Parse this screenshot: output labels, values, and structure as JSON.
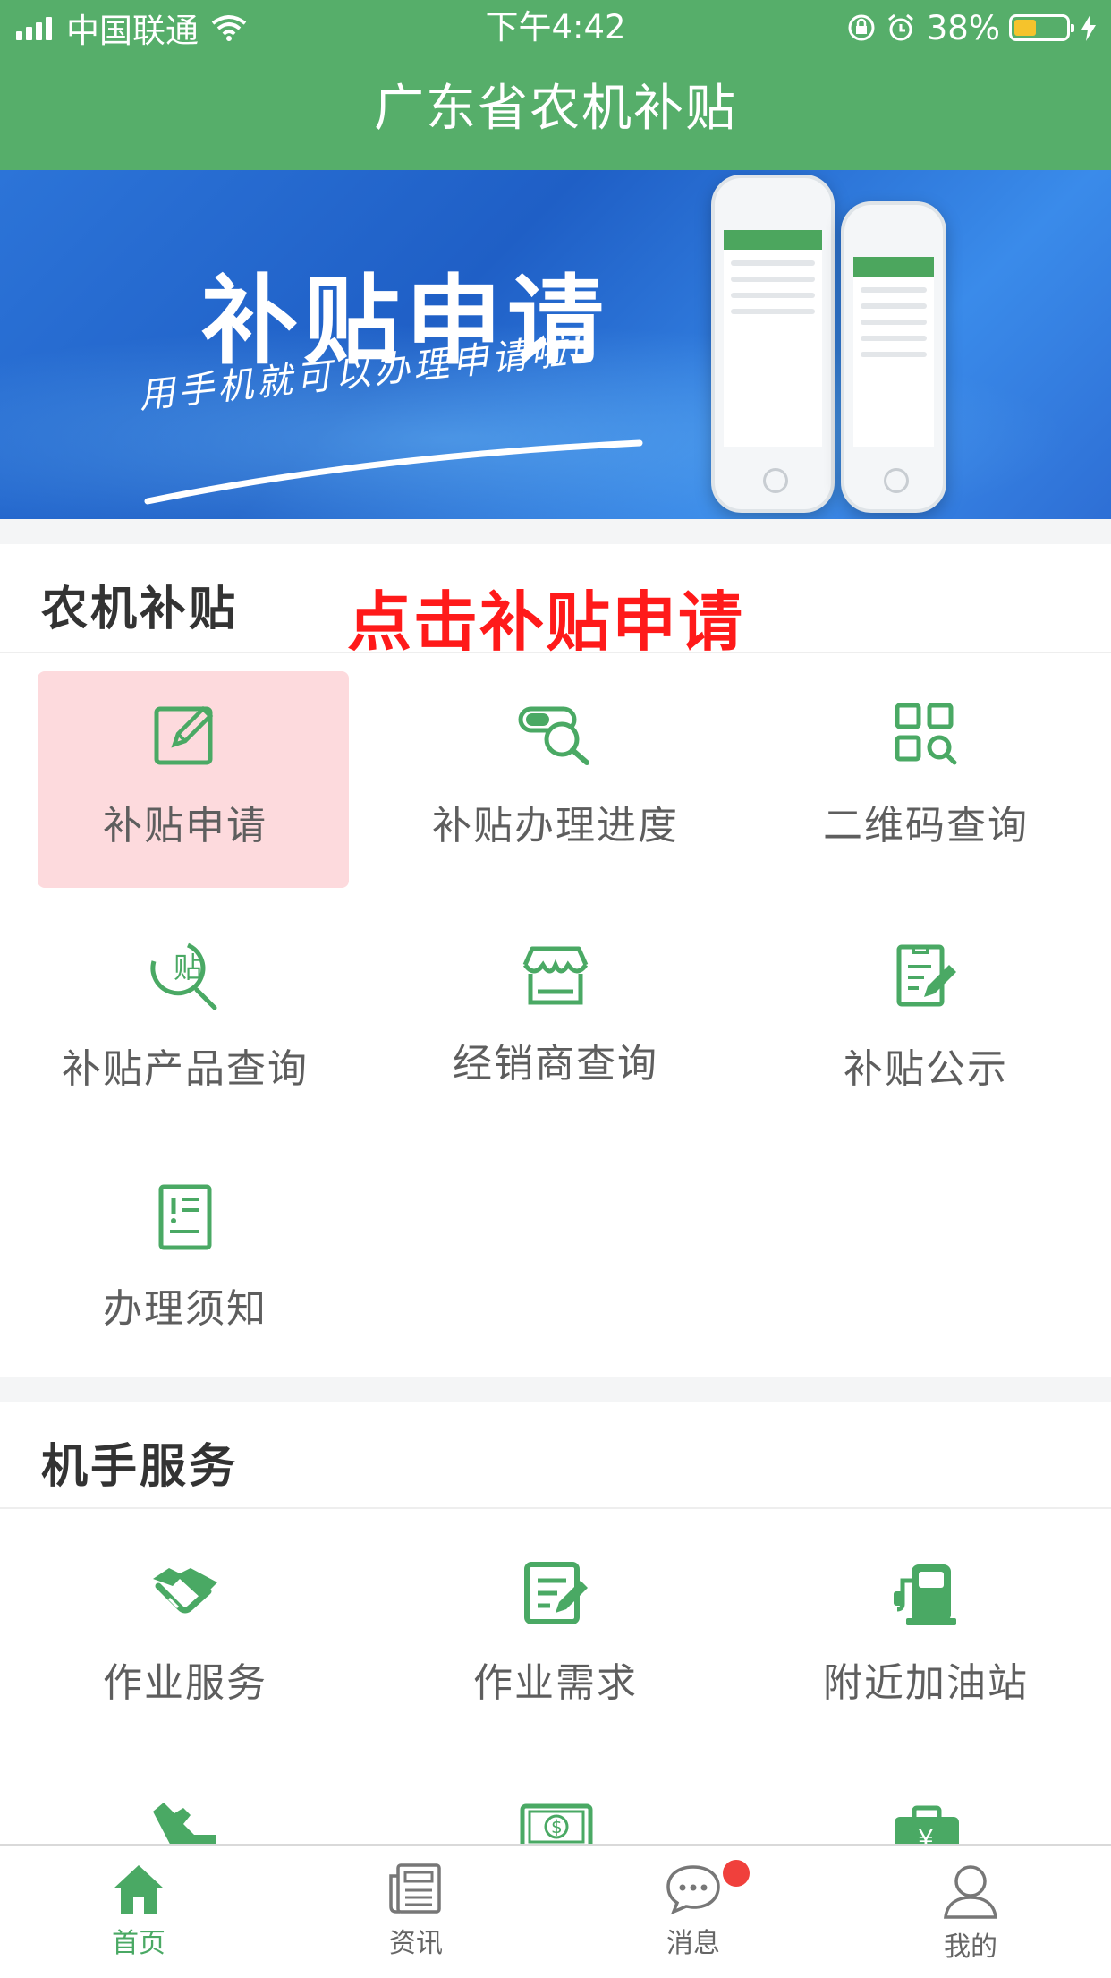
{
  "status_bar": {
    "carrier": "中国联通",
    "time": "下午4:42",
    "battery_percent": "38%"
  },
  "nav": {
    "title": "广东省农机补贴"
  },
  "banner": {
    "title": "补贴申请",
    "subtitle": "用手机就可以办理申请啦!"
  },
  "annotation": "点击补贴申请",
  "subsidy_section": {
    "title": "农机补贴",
    "items": [
      {
        "label": "补贴申请",
        "icon": "edit-icon"
      },
      {
        "label": "补贴办理进度",
        "icon": "search-progress-icon"
      },
      {
        "label": "二维码查询",
        "icon": "qr-search-icon"
      },
      {
        "label": "补贴产品查询",
        "icon": "subsidy-search-icon"
      },
      {
        "label": "经销商查询",
        "icon": "store-icon"
      },
      {
        "label": "补贴公示",
        "icon": "notice-edit-icon"
      },
      {
        "label": "办理须知",
        "icon": "guide-doc-icon"
      }
    ]
  },
  "service_section": {
    "title": "机手服务",
    "items": [
      {
        "label": "作业服务",
        "icon": "handshake-icon"
      },
      {
        "label": "作业需求",
        "icon": "form-edit-icon"
      },
      {
        "label": "附近加油站",
        "icon": "gas-station-icon"
      }
    ]
  },
  "tabbar": {
    "items": [
      {
        "label": "首页",
        "icon": "home-icon",
        "active": true
      },
      {
        "label": "资讯",
        "icon": "news-icon",
        "active": false
      },
      {
        "label": "消息",
        "icon": "message-icon",
        "active": false
      },
      {
        "label": "我的",
        "icon": "user-icon",
        "active": false
      }
    ]
  },
  "colors": {
    "brand_green": "#56ae6a",
    "icon_green": "#4aa964",
    "highlight_pink": "#fddadd",
    "annotation_red": "#ff1a1a",
    "badge_red": "#f0403c"
  }
}
